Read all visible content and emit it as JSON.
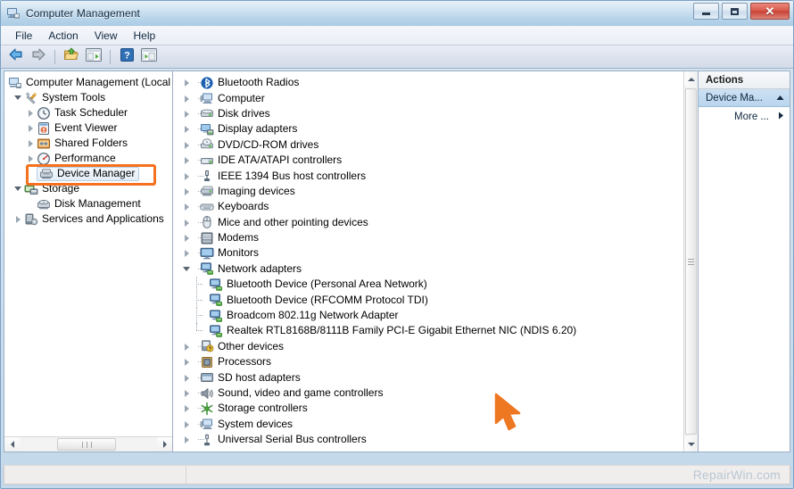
{
  "window": {
    "title": "Computer Management",
    "icon": "computer-management-icon",
    "buttons": {
      "minimize": "minimize",
      "maximize": "maximize",
      "close": "close"
    }
  },
  "menubar": {
    "items": [
      {
        "label": "File"
      },
      {
        "label": "Action"
      },
      {
        "label": "View"
      },
      {
        "label": "Help"
      }
    ]
  },
  "toolbar": {
    "buttons": [
      {
        "name": "back-icon",
        "tip": "Back"
      },
      {
        "name": "forward-icon",
        "tip": "Forward"
      },
      {
        "name": "up-one-level-icon",
        "tip": "Up One Level"
      },
      {
        "name": "show-hide-console-tree-icon",
        "tip": "Show/Hide Console Tree"
      },
      {
        "name": "help-icon",
        "tip": "Help"
      },
      {
        "name": "show-hide-action-pane-icon",
        "tip": "Show/Hide Action Pane"
      }
    ]
  },
  "console_tree": {
    "items": [
      {
        "label": "Computer Management (Local",
        "level": 0,
        "state": "none",
        "icon": "computer-management-icon"
      },
      {
        "label": "System Tools",
        "level": 1,
        "state": "expanded",
        "icon": "system-tools-icon"
      },
      {
        "label": "Task Scheduler",
        "level": 2,
        "state": "collapsed",
        "icon": "task-scheduler-icon"
      },
      {
        "label": "Event Viewer",
        "level": 2,
        "state": "collapsed",
        "icon": "event-viewer-icon"
      },
      {
        "label": "Shared Folders",
        "level": 2,
        "state": "collapsed",
        "icon": "shared-folders-icon"
      },
      {
        "label": "Performance",
        "level": 2,
        "state": "collapsed",
        "icon": "performance-icon"
      },
      {
        "label": "Device Manager",
        "level": 2,
        "state": "none",
        "icon": "device-manager-icon",
        "selected": true,
        "annotated": true
      },
      {
        "label": "Storage",
        "level": 1,
        "state": "expanded",
        "icon": "storage-icon"
      },
      {
        "label": "Disk Management",
        "level": 2,
        "state": "none",
        "icon": "disk-management-icon"
      },
      {
        "label": "Services and Applications",
        "level": 1,
        "state": "collapsed",
        "icon": "services-and-applications-icon"
      }
    ]
  },
  "device_tree": {
    "items": [
      {
        "label": "Bluetooth Radios",
        "level": 0,
        "state": "collapsed",
        "icon": "bluetooth-icon"
      },
      {
        "label": "Computer",
        "level": 0,
        "state": "collapsed",
        "icon": "computer-icon"
      },
      {
        "label": "Disk drives",
        "level": 0,
        "state": "collapsed",
        "icon": "disk-drive-icon"
      },
      {
        "label": "Display adapters",
        "level": 0,
        "state": "collapsed",
        "icon": "display-adapter-icon"
      },
      {
        "label": "DVD/CD-ROM drives",
        "level": 0,
        "state": "collapsed",
        "icon": "dvd-drive-icon"
      },
      {
        "label": "IDE ATA/ATAPI controllers",
        "level": 0,
        "state": "collapsed",
        "icon": "ide-controller-icon"
      },
      {
        "label": "IEEE 1394 Bus host controllers",
        "level": 0,
        "state": "collapsed",
        "icon": "ieee1394-icon"
      },
      {
        "label": "Imaging devices",
        "level": 0,
        "state": "collapsed",
        "icon": "imaging-device-icon"
      },
      {
        "label": "Keyboards",
        "level": 0,
        "state": "collapsed",
        "icon": "keyboard-icon"
      },
      {
        "label": "Mice and other pointing devices",
        "level": 0,
        "state": "collapsed",
        "icon": "mouse-icon"
      },
      {
        "label": "Modems",
        "level": 0,
        "state": "collapsed",
        "icon": "modem-icon"
      },
      {
        "label": "Monitors",
        "level": 0,
        "state": "collapsed",
        "icon": "monitor-icon"
      },
      {
        "label": "Network adapters",
        "level": 0,
        "state": "expanded",
        "icon": "network-adapter-icon"
      },
      {
        "label": "Bluetooth Device (Personal Area Network)",
        "level": 1,
        "state": "none",
        "icon": "network-adapter-icon"
      },
      {
        "label": "Bluetooth Device (RFCOMM Protocol TDI)",
        "level": 1,
        "state": "none",
        "icon": "network-adapter-icon"
      },
      {
        "label": "Broadcom 802.11g Network Adapter",
        "level": 1,
        "state": "none",
        "icon": "network-adapter-icon"
      },
      {
        "label": "Realtek RTL8168B/8111B Family PCI-E Gigabit Ethernet NIC (NDIS 6.20)",
        "level": 1,
        "state": "none",
        "icon": "network-adapter-icon",
        "last": true
      },
      {
        "label": "Other devices",
        "level": 0,
        "state": "collapsed",
        "icon": "other-device-icon"
      },
      {
        "label": "Processors",
        "level": 0,
        "state": "collapsed",
        "icon": "processor-icon"
      },
      {
        "label": "SD host adapters",
        "level": 0,
        "state": "collapsed",
        "icon": "sd-host-adapter-icon"
      },
      {
        "label": "Sound, video and game controllers",
        "level": 0,
        "state": "collapsed",
        "icon": "sound-controller-icon"
      },
      {
        "label": "Storage controllers",
        "level": 0,
        "state": "collapsed",
        "icon": "storage-controller-icon"
      },
      {
        "label": "System devices",
        "level": 0,
        "state": "collapsed",
        "icon": "system-device-icon"
      },
      {
        "label": "Universal Serial Bus controllers",
        "level": 0,
        "state": "collapsed",
        "icon": "usb-controller-icon"
      }
    ]
  },
  "actions_pane": {
    "header": "Actions",
    "group": {
      "label": "Device Ma...",
      "chevron": "chevron-up-icon"
    },
    "items": [
      {
        "label": "More ...",
        "arrow": "chevron-right-icon"
      }
    ]
  },
  "statusbar": {
    "left": "",
    "watermark": "RepairWin.com"
  },
  "cursor": {
    "name": "mouse-cursor-arrow",
    "color": "#ee7722"
  },
  "colors": {
    "annotation": "#f4711f",
    "selection": "#b9d5ee",
    "close_button": "#c63f33",
    "watermark": "#b9c6d4"
  }
}
